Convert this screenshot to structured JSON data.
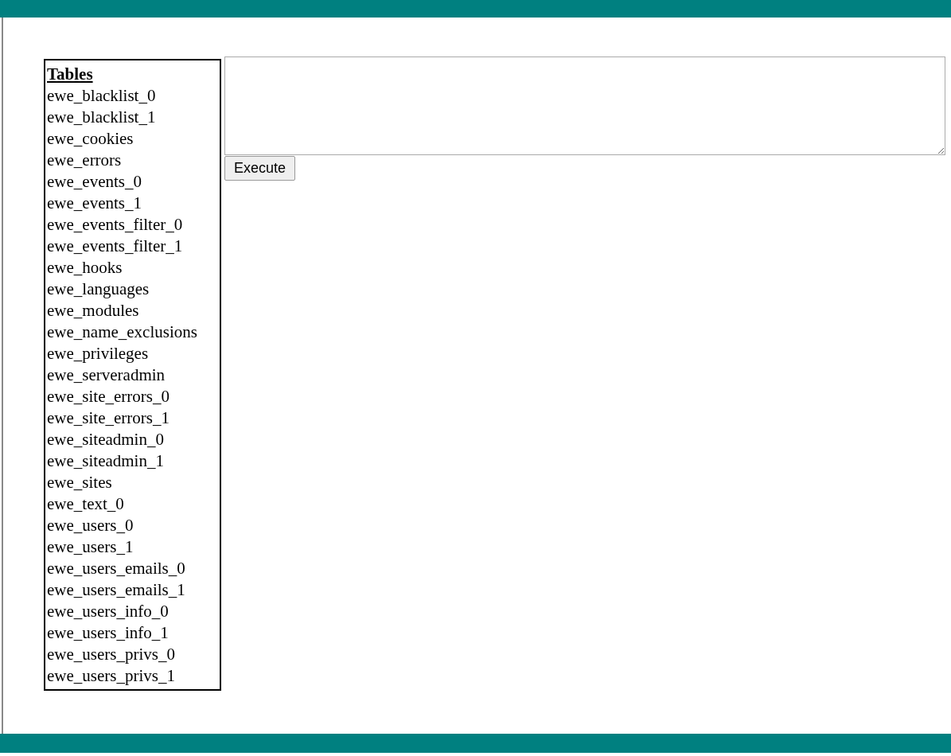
{
  "tables_panel": {
    "heading": "Tables",
    "items": [
      "ewe_blacklist_0",
      "ewe_blacklist_1",
      "ewe_cookies",
      "ewe_errors",
      "ewe_events_0",
      "ewe_events_1",
      "ewe_events_filter_0",
      "ewe_events_filter_1",
      "ewe_hooks",
      "ewe_languages",
      "ewe_modules",
      "ewe_name_exclusions",
      "ewe_privileges",
      "ewe_serveradmin",
      "ewe_site_errors_0",
      "ewe_site_errors_1",
      "ewe_siteadmin_0",
      "ewe_siteadmin_1",
      "ewe_sites",
      "ewe_text_0",
      "ewe_users_0",
      "ewe_users_1",
      "ewe_users_emails_0",
      "ewe_users_emails_1",
      "ewe_users_info_0",
      "ewe_users_info_1",
      "ewe_users_privs_0",
      "ewe_users_privs_1"
    ]
  },
  "query": {
    "execute_button": "Execute"
  }
}
